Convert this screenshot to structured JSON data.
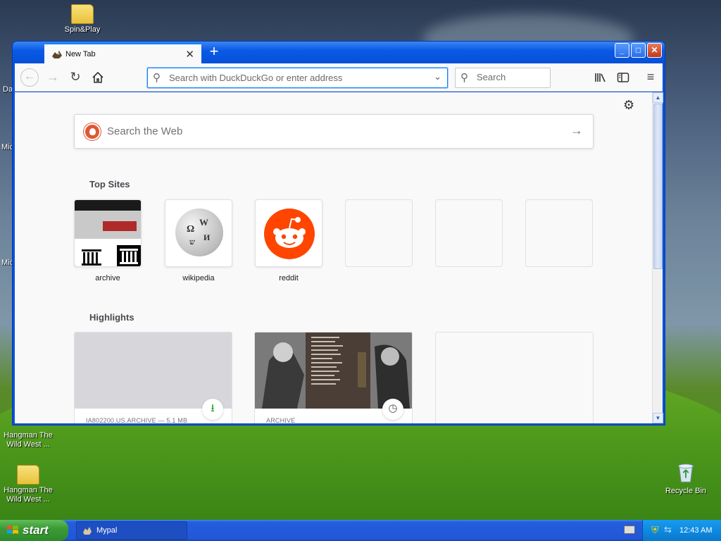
{
  "desktop": {
    "icons": [
      {
        "label": "Spin&Play"
      },
      {
        "label": "Hangman The Wild West ..."
      },
      {
        "label": "Hangman The Wild West ..."
      },
      {
        "label": "Recycle Bin"
      }
    ],
    "edge_labels": [
      "Da",
      "Mic",
      "Mic"
    ]
  },
  "browser": {
    "tab": {
      "title": "New Tab"
    },
    "urlbar": {
      "placeholder": "Search with DuckDuckGo or enter address"
    },
    "searchbar": {
      "placeholder": "Search"
    },
    "newtab": {
      "search_placeholder": "Search the Web",
      "top_sites_title": "Top Sites",
      "top_sites": [
        {
          "label": "archive"
        },
        {
          "label": "wikipedia"
        },
        {
          "label": "reddit"
        }
      ],
      "highlights_title": "Highlights",
      "highlights": [
        {
          "meta": "IA802200.US.ARCHIVE — 5.1 MB"
        },
        {
          "meta": "ARCHIVE"
        }
      ]
    }
  },
  "taskbar": {
    "start_label": "start",
    "task_label": "Mypal",
    "clock": "12:43 AM"
  },
  "colors": {
    "accent": "#0a84ff",
    "xp_blue": "#0a51d9",
    "start_green": "#3c9b37",
    "reddit": "#ff4500",
    "duckduckgo": "#de5833"
  }
}
